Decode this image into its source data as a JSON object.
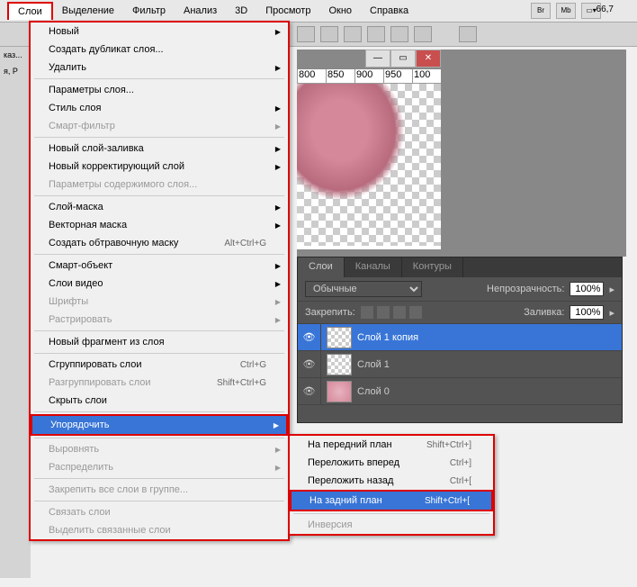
{
  "menubar": {
    "items": [
      "Слои",
      "Выделение",
      "Фильтр",
      "Анализ",
      "3D",
      "Просмотр",
      "Окно",
      "Справка"
    ],
    "active_index": 0
  },
  "toolbar": {
    "br": "Br",
    "mb": "Mb",
    "zoom": "66,7"
  },
  "dropdown": {
    "groups": [
      [
        {
          "label": "Новый",
          "arrow": true
        },
        {
          "label": "Создать дубликат слоя..."
        },
        {
          "label": "Удалить",
          "arrow": true
        }
      ],
      [
        {
          "label": "Параметры слоя..."
        },
        {
          "label": "Стиль слоя",
          "arrow": true
        },
        {
          "label": "Смарт-фильтр",
          "arrow": true,
          "disabled": true
        }
      ],
      [
        {
          "label": "Новый слой-заливка",
          "arrow": true
        },
        {
          "label": "Новый корректирующий слой",
          "arrow": true
        },
        {
          "label": "Параметры содержимого слоя...",
          "disabled": true
        }
      ],
      [
        {
          "label": "Слой-маска",
          "arrow": true
        },
        {
          "label": "Векторная маска",
          "arrow": true
        },
        {
          "label": "Создать обтравочную маску",
          "shortcut": "Alt+Ctrl+G"
        }
      ],
      [
        {
          "label": "Смарт-объект",
          "arrow": true
        },
        {
          "label": "Слои видео",
          "arrow": true
        },
        {
          "label": "Шрифты",
          "arrow": true,
          "disabled": true
        },
        {
          "label": "Растрировать",
          "arrow": true,
          "disabled": true
        }
      ],
      [
        {
          "label": "Новый фрагмент из слоя"
        }
      ],
      [
        {
          "label": "Сгруппировать слои",
          "shortcut": "Ctrl+G"
        },
        {
          "label": "Разгруппировать слои",
          "shortcut": "Shift+Ctrl+G",
          "disabled": true
        },
        {
          "label": "Скрыть слои"
        }
      ],
      [
        {
          "label": "Упорядочить",
          "arrow": true,
          "highlighted": true,
          "redbox": true
        }
      ],
      [
        {
          "label": "Выровнять",
          "arrow": true,
          "disabled": true
        },
        {
          "label": "Распределить",
          "arrow": true,
          "disabled": true
        }
      ],
      [
        {
          "label": "Закрепить все слои в группе...",
          "disabled": true
        }
      ],
      [
        {
          "label": "Связать слои",
          "disabled": true
        },
        {
          "label": "Выделить связанные слои",
          "disabled": true
        }
      ]
    ]
  },
  "submenu": {
    "items": [
      {
        "label": "На передний план",
        "shortcut": "Shift+Ctrl+]"
      },
      {
        "label": "Переложить вперед",
        "shortcut": "Ctrl+]"
      },
      {
        "label": "Переложить назад",
        "shortcut": "Ctrl+["
      },
      {
        "label": "На задний план",
        "shortcut": "Shift+Ctrl+[",
        "highlighted": true,
        "redbox": true
      },
      {
        "label": "Инверсия",
        "disabled": true
      }
    ]
  },
  "ruler": [
    "800",
    "850",
    "900",
    "950",
    "100"
  ],
  "layers_panel": {
    "tabs": [
      "Слои",
      "Каналы",
      "Контуры"
    ],
    "blend": "Обычные",
    "opacity_label": "Непрозрачность:",
    "opacity": "100%",
    "lock_label": "Закрепить:",
    "fill_label": "Заливка:",
    "fill": "100%",
    "layers": [
      {
        "name": "Слой 1 копия",
        "selected": true,
        "thumb": "checker"
      },
      {
        "name": "Слой 1",
        "thumb": "checker"
      },
      {
        "name": "Слой 0",
        "thumb": "pink"
      }
    ]
  },
  "left": {
    "t1": "каз...",
    "t2": "я, P"
  }
}
